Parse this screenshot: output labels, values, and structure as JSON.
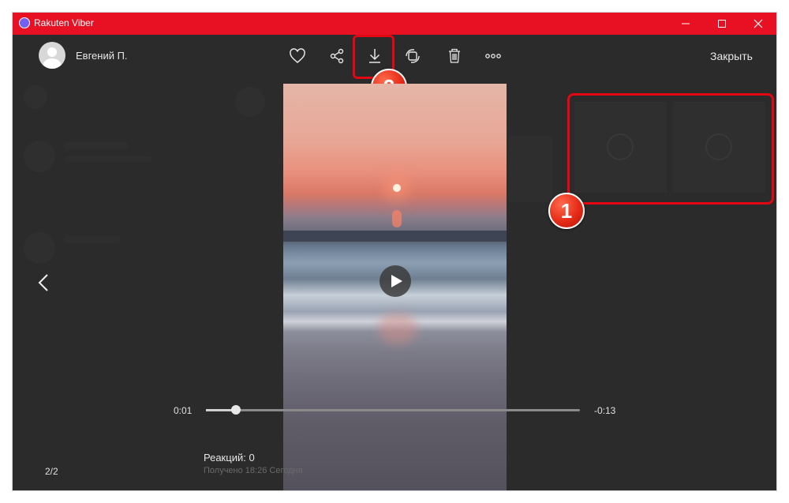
{
  "window": {
    "title": "Rakuten Viber",
    "titlebar_color": "#e81123",
    "controls": [
      "minimize-icon",
      "maximize-icon",
      "close-icon"
    ]
  },
  "header": {
    "contact_name": "Евгений П.",
    "toolbar": [
      "heart-icon",
      "share-icon",
      "download-icon",
      "forward-icon",
      "trash-icon",
      "more-icon"
    ],
    "close_label": "Закрыть"
  },
  "player": {
    "elapsed": "0:01",
    "remaining": "-0:13",
    "progress_fraction": 0.08
  },
  "footer": {
    "counter": "2/2",
    "reactions": "Реакций: 0",
    "received": "Получено 18:26 Сегодня"
  },
  "annotations": [
    {
      "number": "1",
      "target": "thumbnail-strip"
    },
    {
      "number": "2",
      "target": "download-button"
    }
  ],
  "colors": {
    "annotation_red": "#e30613",
    "background": "#3a3a3a"
  }
}
